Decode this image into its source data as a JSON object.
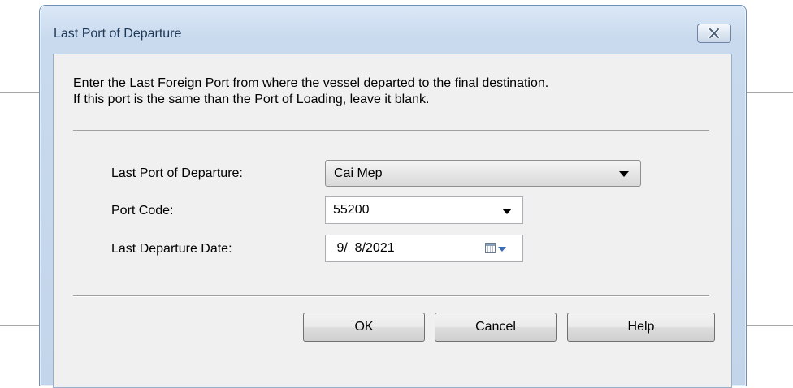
{
  "dialog": {
    "title": "Last Port of Departure",
    "close_icon": "close-icon",
    "description_line1": "Enter the Last Foreign Port from where the vessel departed to the final destination.",
    "description_line2": "If this port is the same than the Port of Loading, leave it blank."
  },
  "form": {
    "last_port_label": "Last Port of Departure:",
    "last_port_value": "Cai Mep",
    "port_code_label": "Port Code:",
    "port_code_value": "55200",
    "date_label": "Last Departure Date:",
    "date_value": " 9/  8/2021",
    "calendar_icon": "calendar-icon"
  },
  "buttons": {
    "ok": "OK",
    "cancel": "Cancel",
    "help": "Help"
  }
}
